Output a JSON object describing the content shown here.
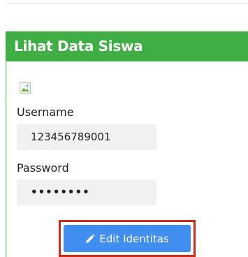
{
  "panel": {
    "title": "Lihat Data Siswa",
    "accent_color": "#3fae44",
    "image_icon": "broken-image-icon"
  },
  "form": {
    "username_label": "Username",
    "username_value": "123456789001",
    "password_label": "Password",
    "password_value": "••••••••"
  },
  "actions": {
    "edit_label": "Edit Identitas",
    "edit_icon": "pencil-icon",
    "button_color": "#3f8ef0",
    "highlight_color": "#d22a16"
  }
}
